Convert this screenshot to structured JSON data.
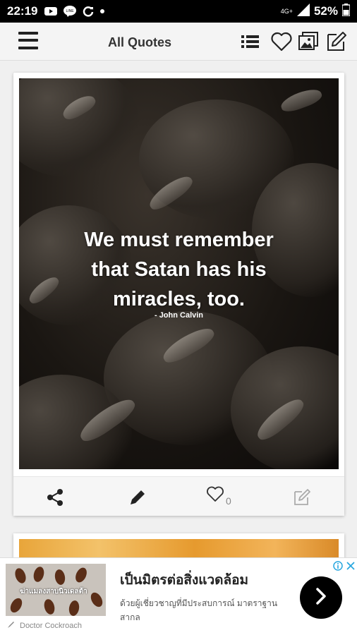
{
  "status_bar": {
    "time": "22:19",
    "network": "4G+",
    "battery": "52%"
  },
  "toolbar": {
    "title": "All Quotes",
    "icons": [
      "menu-icon",
      "list-icon",
      "heart-icon",
      "gallery-icon",
      "edit-icon"
    ]
  },
  "quote": {
    "lines": [
      "We must remember",
      "that Satan has his",
      "miracles, too."
    ],
    "author": "- John Calvin",
    "likes": "0"
  },
  "ad": {
    "image_text": "ฆ่าแมลงสาบนิวเดลต้า",
    "headline": "เป็นมิตรต่อสิ่งแวดล้อม",
    "description": "ด้วยผู้เชี่ยวชาญที่มีประสบการณ์ มาตราฐานสากล",
    "brand": "Doctor Cockroach"
  },
  "colors": {
    "toolbar_bg": "#f4f4f4",
    "status_bg": "#000000",
    "ad_button": "#000000"
  }
}
